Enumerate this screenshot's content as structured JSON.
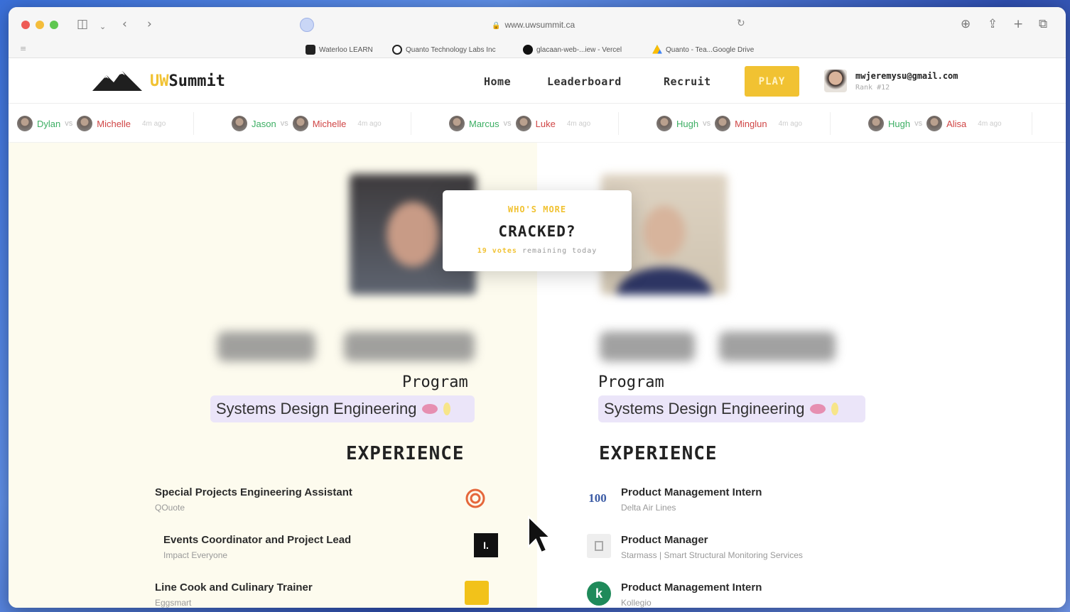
{
  "browser": {
    "url": "www.uwsummit.ca",
    "bookmarks": [
      {
        "label": "Waterloo LEARN",
        "icon": "learn-icon"
      },
      {
        "label": "Quanto Technology Labs Inc",
        "icon": "github-icon"
      },
      {
        "label": "glacaan-web-...iew - Vercel",
        "icon": "vercel-icon"
      },
      {
        "label": "Quanto - Tea...Google Drive",
        "icon": "google-drive-icon"
      }
    ]
  },
  "header": {
    "logo_uw": "UW",
    "logo_rest": "Summit",
    "nav": [
      "Home",
      "Leaderboard",
      "Recruit"
    ],
    "play_label": "PLAY",
    "user_email": "mwjeremysu@gmail.com",
    "user_rank": "Rank #12"
  },
  "ticker": [
    {
      "a": "Dylan",
      "vs": "vs",
      "b": "Michelle",
      "ago": "4m ago"
    },
    {
      "a": "Jason",
      "vs": "vs",
      "b": "Michelle",
      "ago": "4m ago"
    },
    {
      "a": "Marcus",
      "vs": "vs",
      "b": "Luke",
      "ago": "4m ago"
    },
    {
      "a": "Hugh",
      "vs": "vs",
      "b": "Minglun",
      "ago": "4m ago"
    },
    {
      "a": "Hugh",
      "vs": "vs",
      "b": "Alisa",
      "ago": "4m ago"
    }
  ],
  "card": {
    "eyebrow": "WHO'S MORE",
    "title": "CRACKED?",
    "votes": "19 votes",
    "remaining": "remaining today"
  },
  "left": {
    "program_label": "Program",
    "program": "Systems Design Engineering",
    "experience_title": "EXPERIENCE",
    "experience": [
      {
        "role": "Special Projects Engineering Assistant",
        "company": "QOuote"
      },
      {
        "role": "Events Coordinator and Project Lead",
        "company": "Impact Everyone"
      },
      {
        "role": "Line Cook and Culinary Trainer",
        "company": "Eggsmart"
      }
    ]
  },
  "right": {
    "program_label": "Program",
    "program": "Systems Design Engineering",
    "experience_title": "EXPERIENCE",
    "experience": [
      {
        "role": "Product Management Intern",
        "company": "Delta Air Lines"
      },
      {
        "role": "Product Manager",
        "company": "Starmass | Smart Structural Monitoring Services"
      },
      {
        "role": "Product Management Intern",
        "company": "Kollegio"
      }
    ]
  },
  "logos": {
    "impact_letter": "I.",
    "kollegio_letter": "k",
    "delta_text": "100"
  },
  "colors": {
    "accent": "#f1c232",
    "left_bg": "#fdfbee",
    "pill_bg": "#ebe5f9",
    "winner": "#3cae63",
    "loser": "#d04545"
  }
}
